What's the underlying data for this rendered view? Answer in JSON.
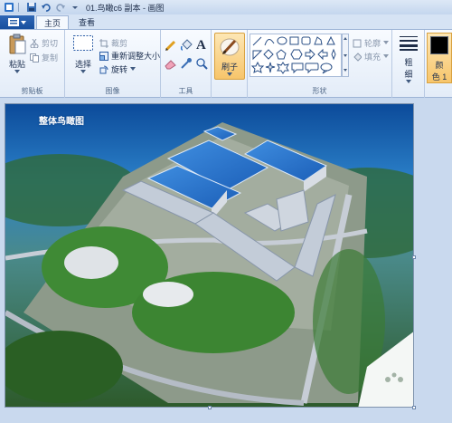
{
  "window": {
    "title": "01.鸟瞰c6 副本 - 画图"
  },
  "tabs": [
    {
      "label": "主页",
      "active": true
    },
    {
      "label": "查看",
      "active": false
    }
  ],
  "groups": {
    "clipboard": {
      "label": "剪贴板",
      "paste": "粘贴",
      "cut": "剪切",
      "copy": "复制"
    },
    "image": {
      "label": "图像",
      "select": "选择",
      "crop": "裁剪",
      "resize": "重新调整大小",
      "rotate": "旋转"
    },
    "tools": {
      "label": "工具"
    },
    "brushes": {
      "label": "刷子"
    },
    "shapes": {
      "label": "形状",
      "outline": "轮廓",
      "fill": "填充"
    },
    "size": {
      "label_line1": "粗",
      "label_line2": "细"
    },
    "colors": {
      "color1_line1": "颜",
      "color1_line2": "色 1",
      "color1_value": "#000000"
    }
  },
  "picture": {
    "title": "整体鸟瞰图"
  },
  "colors": {
    "accent": "#f7c56b",
    "ribbon": "#e3ecf8"
  }
}
